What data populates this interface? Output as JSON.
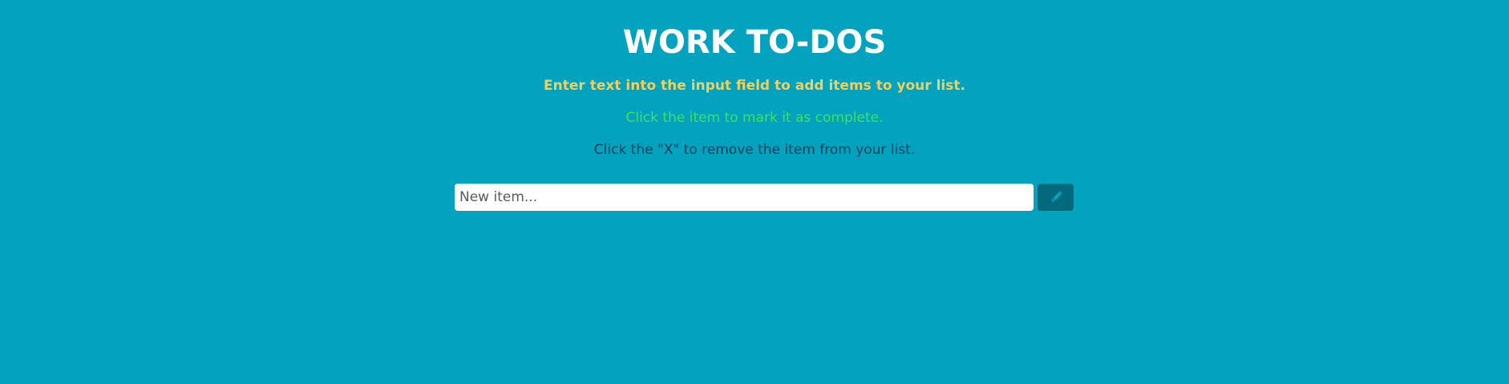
{
  "header": {
    "title": "WORK TO-DOS"
  },
  "instructions": [
    "Enter text into the input field to add items to your list.",
    "Click the item to mark it as complete.",
    "Click the \"X\" to remove the item from your list."
  ],
  "form": {
    "input_placeholder": "New item...",
    "input_value": "",
    "add_button_icon": "pencil-icon"
  },
  "colors": {
    "background": "#03a2bf",
    "title": "#ffffff",
    "instruction_1": "#f2cf5c",
    "instruction_2": "#41e159",
    "instruction_3": "#0b3d57",
    "button_bg": "#036a7d",
    "button_icon": "#03a2bf"
  }
}
